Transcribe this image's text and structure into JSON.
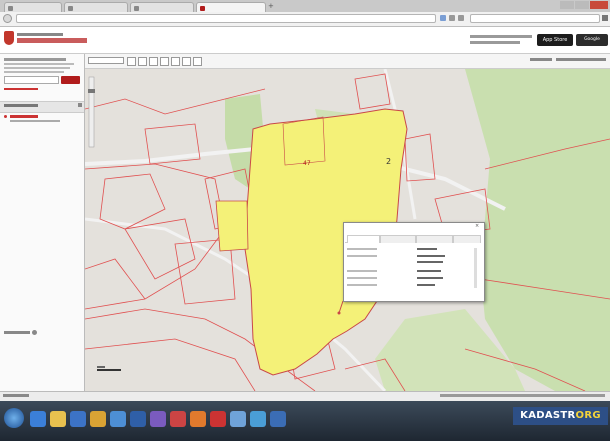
{
  "browser": {
    "tabs": [
      {
        "label": "",
        "active": false
      },
      {
        "label": "",
        "active": false
      },
      {
        "label": "",
        "active": false
      },
      {
        "label": "",
        "active": true
      }
    ],
    "url": "",
    "search_placeholder": ""
  },
  "app": {
    "title": "",
    "appstore_label": "App Store",
    "gplay_label": "Google"
  },
  "sidebar": {
    "search_value": "",
    "find_label": "",
    "found_title": ""
  },
  "map": {
    "parcel_label": "47",
    "parcel_number": "2",
    "accent_color": "#b11c1c",
    "parcel_fill": "#f4f178",
    "border_color": "#e05050"
  },
  "popup": {
    "title": "",
    "tabs": [
      "",
      "",
      "",
      ""
    ]
  },
  "watermark": {
    "prefix": "KADASTR",
    "suffix": "ORG"
  }
}
